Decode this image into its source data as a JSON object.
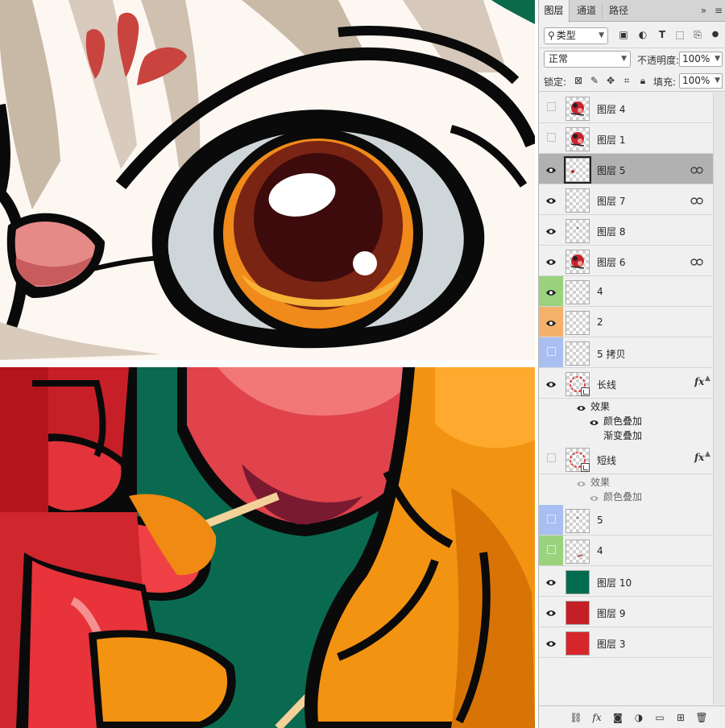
{
  "panel": {
    "tabs": [
      {
        "label": "图层",
        "active": true
      },
      {
        "label": "通道",
        "active": false
      },
      {
        "label": "路径",
        "active": false
      }
    ],
    "collapse_icon": "double-chevron-right-icon",
    "menu_icon": "panel-menu-icon",
    "filter": {
      "kind_label": "类型",
      "icons": [
        "image-filter-icon",
        "adjustment-filter-icon",
        "type-filter-icon",
        "shape-filter-icon",
        "smart-object-filter-icon",
        "filter-toggle-icon"
      ]
    },
    "blend": {
      "mode": "正常",
      "opacity_label": "不透明度:",
      "opacity_value": "100%",
      "lock_label": "锁定:",
      "fill_label": "填充:",
      "fill_value": "100%"
    },
    "layers": [
      {
        "name": "图层 4",
        "visible": false,
        "label_color": "",
        "thumb": "art-a",
        "link": false,
        "fx": false,
        "selected": false
      },
      {
        "name": "图层 1",
        "visible": false,
        "label_color": "",
        "thumb": "art-b",
        "link": false,
        "fx": false,
        "selected": false
      },
      {
        "name": "图层 5",
        "visible": true,
        "label_color": "",
        "thumb": "dot",
        "link": true,
        "fx": false,
        "selected": true
      },
      {
        "name": "图层 7",
        "visible": true,
        "label_color": "",
        "thumb": "empty",
        "link": true,
        "fx": false,
        "selected": false
      },
      {
        "name": "图层 8",
        "visible": true,
        "label_color": "",
        "thumb": "speck",
        "link": false,
        "fx": false,
        "selected": false
      },
      {
        "name": "图层 6",
        "visible": true,
        "label_color": "",
        "thumb": "art-c",
        "link": true,
        "fx": false,
        "selected": false
      },
      {
        "name": "4",
        "visible": true,
        "label_color": "#9ad27e",
        "thumb": "empty",
        "link": false,
        "fx": false,
        "selected": false
      },
      {
        "name": "2",
        "visible": true,
        "label_color": "#f4b169",
        "thumb": "empty",
        "link": false,
        "fx": false,
        "selected": false
      },
      {
        "name": "5 拷贝",
        "visible": false,
        "label_color": "#a9bff2",
        "thumb": "empty",
        "link": false,
        "fx": false,
        "selected": false
      },
      {
        "name": "长线",
        "visible": true,
        "label_color": "",
        "thumb": "circle",
        "link": false,
        "fx": true,
        "selected": false,
        "effects": {
          "title": "效果",
          "items": [
            {
              "name": "颜色叠加",
              "visible": true
            },
            {
              "name": "渐变叠加",
              "visible": false
            }
          ]
        }
      },
      {
        "name": "短线",
        "visible": false,
        "label_color": "",
        "thumb": "circle",
        "link": false,
        "fx": true,
        "selected": false,
        "effects": {
          "title": "效果",
          "items": [
            {
              "name": "颜色叠加",
              "visible": true
            }
          ]
        }
      },
      {
        "name": "5",
        "visible": false,
        "label_color": "#a9bff2",
        "thumb": "speck",
        "link": false,
        "fx": false,
        "selected": false
      },
      {
        "name": "4",
        "visible": false,
        "label_color": "#9ad27e",
        "thumb": "speck2",
        "link": false,
        "fx": false,
        "selected": false
      },
      {
        "name": "图层 10",
        "visible": true,
        "label_color": "",
        "thumb": "fill-green",
        "link": false,
        "fx": false,
        "selected": false
      },
      {
        "name": "图层 9",
        "visible": true,
        "label_color": "",
        "thumb": "fill-red",
        "link": false,
        "fx": false,
        "selected": false
      },
      {
        "name": "图层 3",
        "visible": true,
        "label_color": "",
        "thumb": "fill-red2",
        "link": false,
        "fx": false,
        "selected": false
      }
    ],
    "footer_icons": [
      "link-layers-icon",
      "fx-icon",
      "add-mask-icon",
      "adjustment-layer-icon",
      "new-group-icon",
      "new-layer-icon",
      "delete-layer-icon"
    ],
    "colors": {
      "green": "#006b4f",
      "red": "#c41f26",
      "red2": "#d5262b"
    }
  }
}
